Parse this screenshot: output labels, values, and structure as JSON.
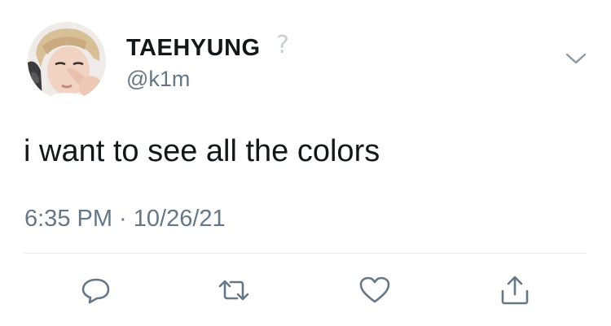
{
  "tweet": {
    "display_name": "TAEHYUNG",
    "handle": "@k1m",
    "text": "i want to see all the colors",
    "timestamp": "6:35 PM · 10/26/21"
  },
  "icons": {
    "badge": "?",
    "menu": "chevron-down-icon",
    "reply": "reply-icon",
    "retweet": "retweet-icon",
    "like": "heart-icon",
    "share": "share-icon"
  },
  "colors": {
    "text": "#14171a",
    "secondary": "#657786",
    "icon": "#657786",
    "divider": "#e1e8ed"
  }
}
